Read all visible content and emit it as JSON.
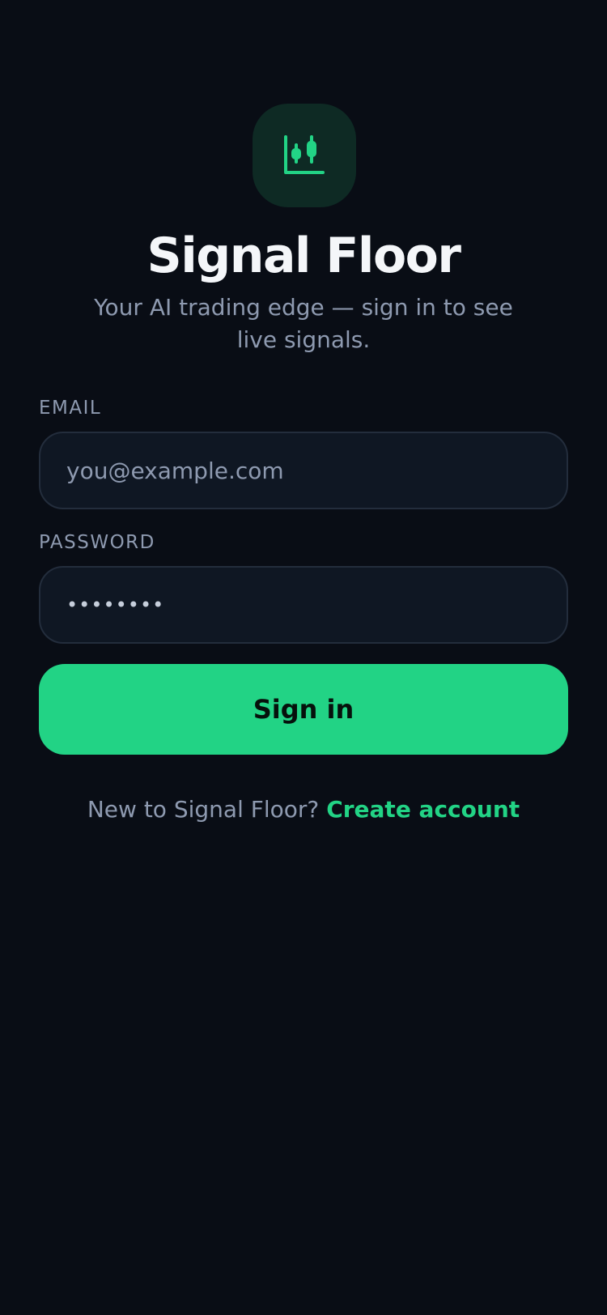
{
  "app": {
    "title": "Signal Floor",
    "subtitle": "Your AI trading edge — sign in to see live signals.",
    "logo_icon": "candlestick-chart-icon"
  },
  "colors": {
    "background": "#090d15",
    "accent": "#22d385",
    "logo_bg": "#0e2a24",
    "input_bg": "#0f1723",
    "muted_text": "#8e9ab0"
  },
  "form": {
    "email": {
      "label": "EMAIL",
      "value": "",
      "placeholder": "you@example.com"
    },
    "password": {
      "label": "PASSWORD",
      "masked_value": "••••••••"
    },
    "submit_label": "Sign in"
  },
  "footer": {
    "prompt": "New to Signal Floor?",
    "link_label": "Create account"
  }
}
